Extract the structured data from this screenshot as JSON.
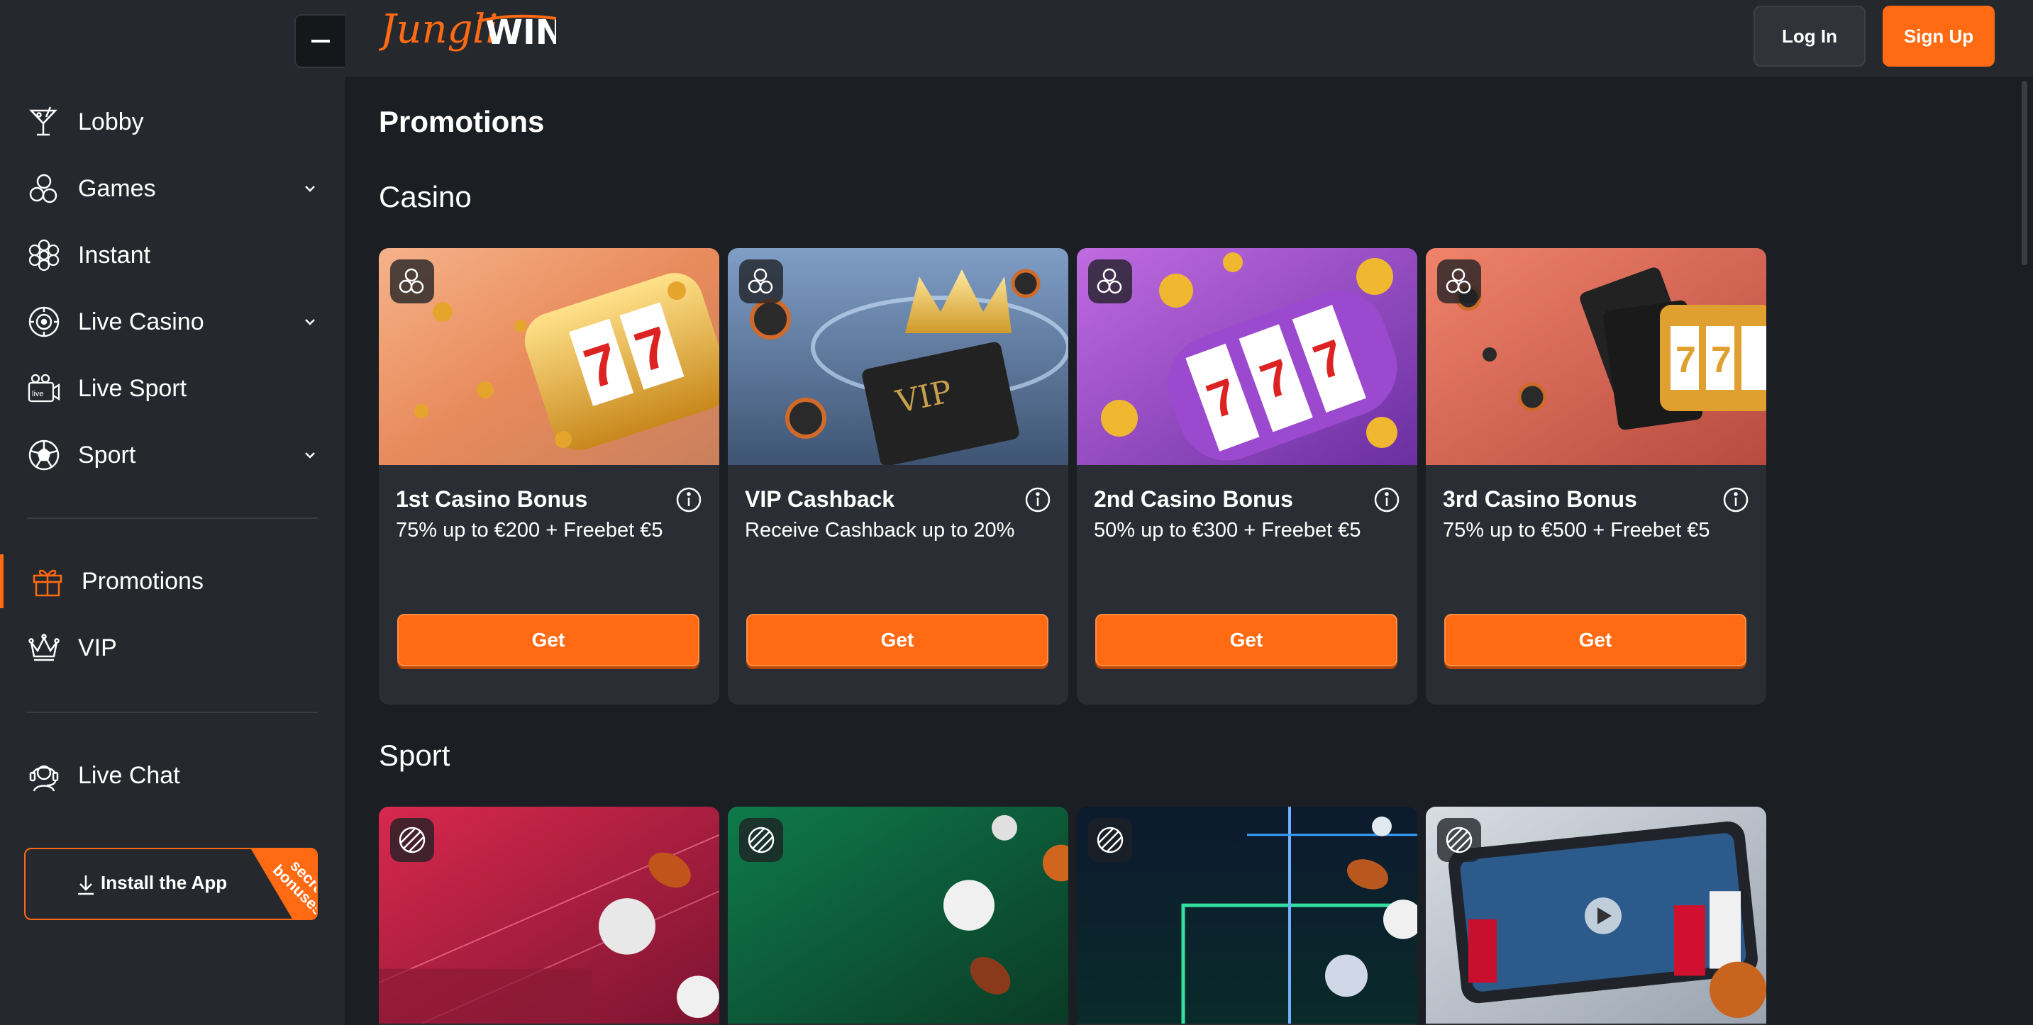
{
  "colors": {
    "accent": "#ff6a13",
    "sidebar": "#25282d",
    "background": "#1b1e23",
    "card": "#2a2d33"
  },
  "sidebar": {
    "collapse_icon": "minus-icon",
    "items": [
      {
        "label": "Lobby",
        "icon": "cocktail-icon"
      },
      {
        "label": "Games",
        "icon": "cherries-icon",
        "expandable": true
      },
      {
        "label": "Instant",
        "icon": "flower-icon"
      },
      {
        "label": "Live Casino",
        "icon": "chip-icon",
        "expandable": true
      },
      {
        "label": "Live Sport",
        "icon": "live-camera-icon"
      },
      {
        "label": "Sport",
        "icon": "soccer-ball-icon",
        "expandable": true
      },
      {
        "label": "Promotions",
        "icon": "gift-icon",
        "active": true
      },
      {
        "label": "VIP",
        "icon": "crown-icon"
      },
      {
        "label": "Live Chat",
        "icon": "headset-icon"
      }
    ],
    "install": {
      "label": "Install the App",
      "ribbon": "secret bonuses"
    }
  },
  "header": {
    "logo_left": "Jungli",
    "logo_right": "WIN",
    "login": "Log In",
    "signup": "Sign Up"
  },
  "main": {
    "title": "Promotions",
    "casino_title": "Casino",
    "sport_title": "Sport",
    "casino_cards": [
      {
        "title": "1st Casino Bonus",
        "desc": "75% up to €200 + Freebet €5",
        "button": "Get"
      },
      {
        "title": "VIP Cashback",
        "desc": "Receive Cashback up to 20%",
        "button": "Get"
      },
      {
        "title": "2nd Casino Bonus",
        "desc": "50% up to €300 + Freebet €5",
        "button": "Get"
      },
      {
        "title": "3rd Casino Bonus",
        "desc": "75% up to €500 + Freebet €5",
        "button": "Get"
      }
    ],
    "sport_cards": [
      {
        "icon": "sport-ball-icon"
      },
      {
        "icon": "sport-ball-icon"
      },
      {
        "icon": "sport-ball-icon"
      },
      {
        "icon": "sport-ball-icon"
      }
    ]
  }
}
